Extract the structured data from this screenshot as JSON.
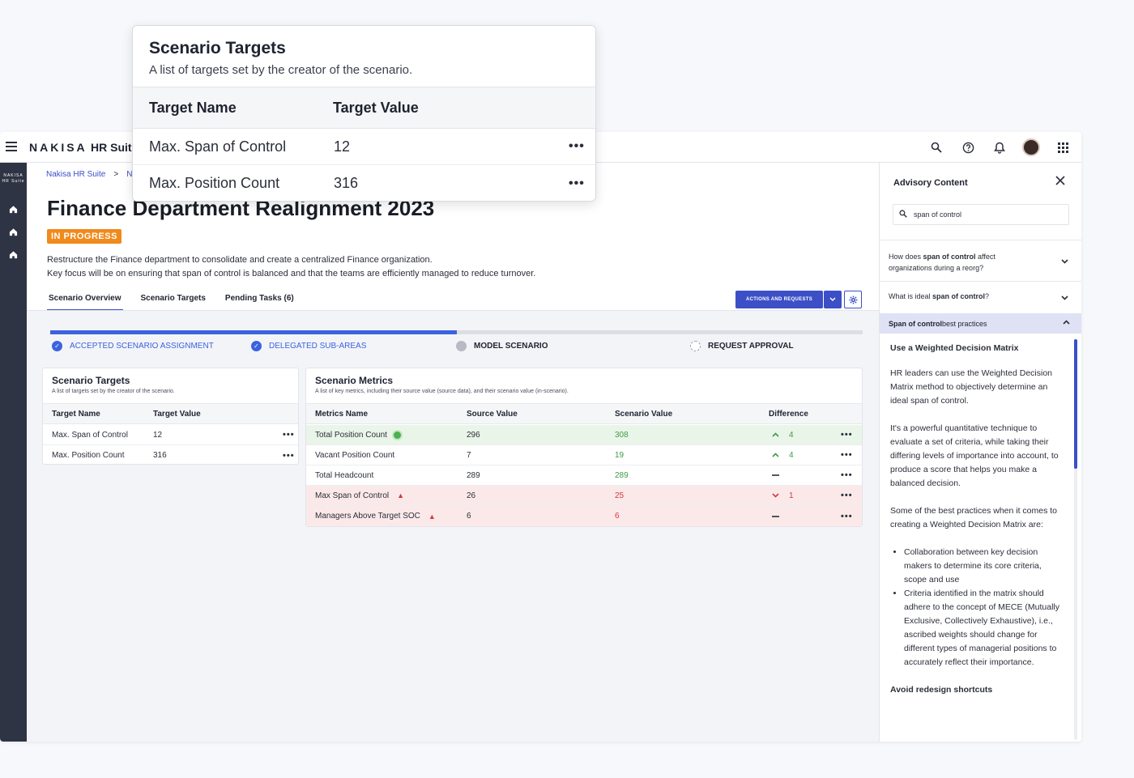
{
  "app": {
    "brand": "NAKISA",
    "brand_sub": "HR Suite",
    "sidenav_logo_line1": "NAKISA",
    "sidenav_logo_line2": "HR Suite"
  },
  "breadcrumb": [
    "Nakisa HR Suite",
    "N"
  ],
  "page": {
    "title": "Finance Department Realignment 2023",
    "status": "IN PROGRESS",
    "description_line1": "Restructure the Finance department to consolidate and create a centralized Finance organization.",
    "description_line2": "Key focus will be on ensuring that span of control is balanced and that the teams are efficiently managed to reduce turnover."
  },
  "tabs": [
    "Scenario Overview",
    "Scenario Targets",
    "Pending Tasks (6)"
  ],
  "toolbar": {
    "actions_label": "ACTIONS AND REQUESTS"
  },
  "progress": {
    "fraction": 0.5,
    "steps": [
      {
        "label": "ACCEPTED SCENARIO ASSIGNMENT",
        "state": "done"
      },
      {
        "label": "DELEGATED SUB-AREAS",
        "state": "done"
      },
      {
        "label": "MODEL SCENARIO",
        "state": "current"
      },
      {
        "label": "REQUEST APPROVAL",
        "state": "pending"
      }
    ]
  },
  "targets_card": {
    "title": "Scenario Targets",
    "subtitle": "A list of targets set by the creator of the scenario.",
    "columns": [
      "Target Name",
      "Target Value"
    ],
    "rows": [
      {
        "name": "Max. Span of Control",
        "value": "12"
      },
      {
        "name": "Max. Position Count",
        "value": "316"
      }
    ]
  },
  "metrics_card": {
    "title": "Scenario Metrics",
    "subtitle": "A list of key metrics, including their source value (source data), and their scenario value (in-scenario).",
    "columns": [
      "Metrics Name",
      "Source Value",
      "Scenario Value",
      "Difference"
    ],
    "rows": [
      {
        "name": "Total Position Count",
        "source": "296",
        "scenario": "308",
        "diff": "4",
        "trend": "up",
        "status": "ok"
      },
      {
        "name": "Vacant Position Count",
        "source": "7",
        "scenario": "19",
        "diff": "4",
        "trend": "up",
        "status": "none"
      },
      {
        "name": "Total Headcount",
        "source": "289",
        "scenario": "289",
        "diff": "",
        "trend": "flat",
        "status": "none"
      },
      {
        "name": "Max Span of Control",
        "source": "26",
        "scenario": "25",
        "diff": "1",
        "trend": "down",
        "status": "warn"
      },
      {
        "name": "Managers Above Target SOC",
        "source": "6",
        "scenario": "6",
        "diff": "",
        "trend": "flat",
        "status": "warn"
      }
    ]
  },
  "advisory": {
    "title": "Advisory Content",
    "search_value": "span of control",
    "faq1_pre": "How does ",
    "faq1_bold": "span of control",
    "faq1_post": " affect organizations during a reorg?",
    "faq2_pre": "What is ideal ",
    "faq2_bold": "span of control",
    "faq2_post": "?",
    "faq3_bold": "Span of control",
    "faq3_post": " best practices",
    "heading": "Use a Weighted Decision Matrix",
    "para1": "HR leaders can use the Weighted Decision Matrix method to objectively determine an ideal span of control.",
    "para2": "It's a powerful quantitative technique to evaluate a set of criteria, while taking their differing levels of importance into account, to produce a score that helps you make a balanced decision.",
    "para3": "Some of the best practices when it comes to creating a Weighted Decision Matrix are:",
    "bullet1": "Collaboration between key decision makers to determine its core criteria, scope and use",
    "bullet2": "Criteria identified in the matrix should adhere to the concept of MECE (Mutually Exclusive, Collectively Exhaustive), i.e., ascribed weights should change for different types of managerial positions to accurately reflect their importance.",
    "heading2": "Avoid redesign shortcuts"
  },
  "popout": {
    "title": "Scenario Targets",
    "subtitle": "A list of targets set by the creator of the scenario.",
    "columns": [
      "Target Name",
      "Target Value"
    ],
    "rows": [
      {
        "name": "Max. Span of Control",
        "value": "12"
      },
      {
        "name": "Max. Position Count",
        "value": "316"
      }
    ]
  },
  "icons": {
    "more": "•••",
    "up": "⌃",
    "down": "⌄",
    "flat": "—",
    "warn": "▲",
    "ok": "●",
    "check": "✓",
    "close": "✕",
    "chevron_down": "⌄",
    "chevron_up": "⌃",
    "search": "⌕",
    "gear": "⚙",
    "home": "⌂"
  },
  "colors": {
    "accent": "#3c4fc7",
    "progress": "#3c62e0",
    "status_badge": "#f08a1c",
    "ok_row": "#eaf5e9",
    "warn_row": "#fbe9ea",
    "up_green": "#3f9a45",
    "down_red": "#d43a3a"
  }
}
